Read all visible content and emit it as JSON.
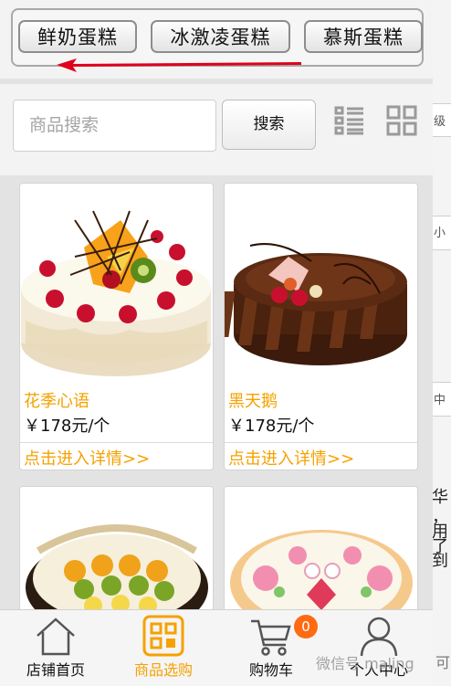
{
  "categories": [
    "鲜奶蛋糕",
    "冰激凌蛋糕",
    "慕斯蛋糕"
  ],
  "search": {
    "placeholder": "商品搜索",
    "button": "搜索"
  },
  "products": [
    {
      "name": "花季心语",
      "price": "￥178元/个",
      "detail": "点击进入详情>>"
    },
    {
      "name": "黑天鹅",
      "price": "￥178元/个",
      "detail": "点击进入详情>>"
    }
  ],
  "tabs": [
    {
      "label": "店铺首页",
      "active": false
    },
    {
      "label": "商品选购",
      "active": true
    },
    {
      "label": "购物车",
      "active": false
    },
    {
      "label": "个人中心",
      "active": false
    }
  ],
  "cart_badge": "0",
  "watermark": "微信号 maling",
  "background_fragments": [
    "级",
    "小",
    "中",
    "华",
    "，",
    "用",
    "了",
    "到",
    "可"
  ],
  "colors": {
    "accent": "#f5a100",
    "badge": "#ff6a13",
    "arrow": "#e0001a"
  }
}
